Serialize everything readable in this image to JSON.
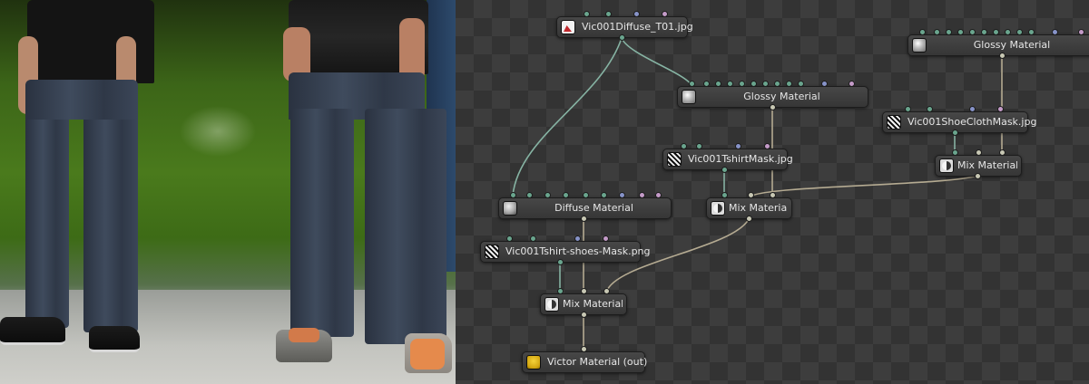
{
  "viewport": {
    "label": "",
    "content": "render preview"
  },
  "node_editor": {
    "nodes": [
      {
        "label": "Vic001Diffuse_T01.jpg",
        "icon": "image-texture-icon"
      },
      {
        "label": "Glossy Material",
        "icon": "sphere-material-icon"
      },
      {
        "label": "Glossy Material",
        "icon": "sphere-material-icon"
      },
      {
        "label": "Vic001ShoeClothMask.jpg",
        "icon": "mask-texture-icon"
      },
      {
        "label": "Vic001TshirtMask.jpg",
        "icon": "mask-texture-icon"
      },
      {
        "label": "Mix Material",
        "icon": "mix-material-icon"
      },
      {
        "label": "Diffuse Material",
        "icon": "sphere-material-icon"
      },
      {
        "label": "Mix Material",
        "icon": "mix-material-icon"
      },
      {
        "label": "Vic001Tshirt-shoes-Mask.png",
        "icon": "mask-texture-icon"
      },
      {
        "label": "Mix Material",
        "icon": "mix-material-icon"
      },
      {
        "label": "Victor Material (out)",
        "icon": "output-material-icon"
      }
    ],
    "pin_colors": {
      "texture": "#6aa58e",
      "vector": "#8793c8",
      "float": "#c49bc8",
      "material": "#c8c8b4"
    },
    "wire_colors": {
      "texture": "#86b3a3",
      "material": "#b5ab92"
    }
  }
}
